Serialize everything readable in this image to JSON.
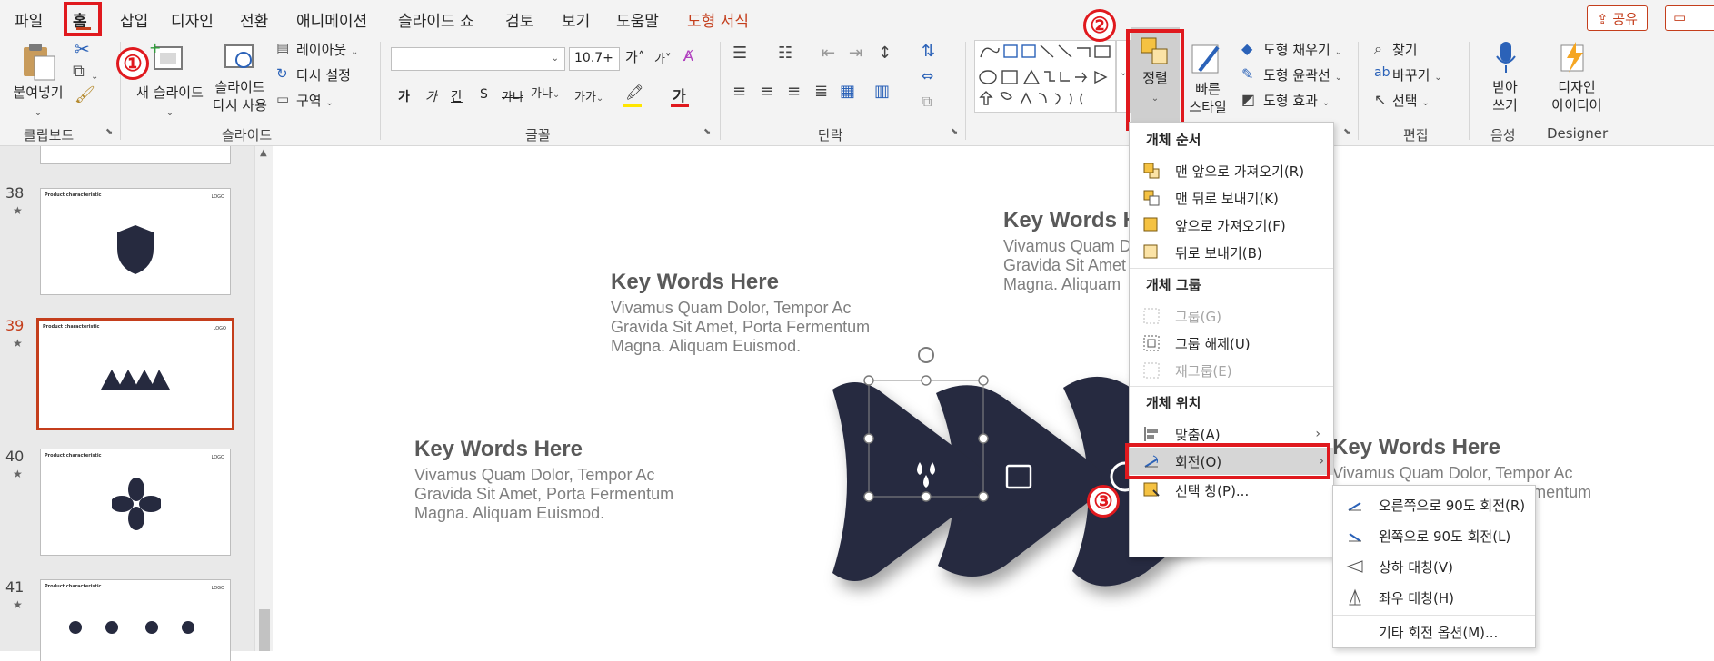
{
  "tabs": {
    "items": [
      "파일",
      "홈",
      "삽입",
      "디자인",
      "전환",
      "애니메이션",
      "슬라이드 쇼",
      "검토",
      "보기",
      "도움말",
      "도형 서식"
    ],
    "share": "공유"
  },
  "badges": [
    "①",
    "②",
    "③"
  ],
  "ribbon": {
    "clipboard": {
      "label": "클립보드",
      "paste": "붙여넣기"
    },
    "slides": {
      "label": "슬라이드",
      "new_slide": "새 슬라이드",
      "reuse": "슬라이드\n다시 사용",
      "layout": "레이아웃",
      "reset": "다시 설정",
      "section": "구역"
    },
    "font": {
      "label": "글꼴",
      "font_name": "",
      "font_size": "10.7+",
      "grow": "가",
      "shrink": "가",
      "bold": "가",
      "italic": "가",
      "underline": "간",
      "shadow": "S",
      "strike": "가나",
      "spacing": "가나",
      "case": "가가",
      "font_color": "가"
    },
    "paragraph": {
      "label": "단락"
    },
    "drawing": {
      "arrange": "정렬",
      "quick_styles": "빠른\n스타일",
      "fill": "도형 채우기",
      "outline": "도형 윤곽선",
      "effects": "도형 효과"
    },
    "editing": {
      "label": "편집",
      "find": "찾기",
      "replace": "바꾸기",
      "select": "선택"
    },
    "voice": {
      "label": "음성",
      "dictate": "받아\n쓰기"
    },
    "designer": {
      "label": "Designer",
      "ideas": "디자인\n아이디어"
    }
  },
  "thumbnails": [
    {
      "num": "38",
      "title": "Product characteristic"
    },
    {
      "num": "39",
      "title": "Product characteristic"
    },
    {
      "num": "40",
      "title": "Product characteristic"
    },
    {
      "num": "41",
      "title": "Product characteristic"
    }
  ],
  "thumb_logo": "LOGO",
  "thumb_star": "★",
  "slide": {
    "blocks": [
      {
        "title": "Key Words Here",
        "lines": [
          "Vivamus Quam Dolor, Tempor Ac",
          "Gravida Sit Amet, Porta Fermentum",
          "Magna. Aliquam Euismod."
        ]
      },
      {
        "title": "Key Words Here",
        "lines": [
          "Vivamus Quam Dolor, Tempor Ac",
          "Gravida Sit Amet, Porta Fermentum",
          "Magna. Aliquam Euismod."
        ]
      },
      {
        "title": "Key Words Here",
        "lines": [
          "Vivamus Quam D",
          "Gravida Sit Amet",
          "Magna. Aliquam"
        ]
      },
      {
        "title": "Key Words Here",
        "lines": [
          "Vivamus Quam Dolor, Tempor Ac",
          "Gravida Sit Amet, Porta Fermentum",
          ""
        ]
      }
    ],
    "shape_color": "#262a3f"
  },
  "arrange_menu": {
    "order_header": "개체 순서",
    "bring_front": "맨 앞으로 가져오기(R)",
    "send_back": "맨 뒤로 보내기(K)",
    "bring_forward": "앞으로 가져오기(F)",
    "send_backward": "뒤로 보내기(B)",
    "group_header": "개체 그룹",
    "group": "그룹(G)",
    "ungroup": "그룹 해제(U)",
    "regroup": "재그룹(E)",
    "position_header": "개체 위치",
    "align": "맞춤(A)",
    "rotate": "회전(O)",
    "selection_pane": "선택 창(P)..."
  },
  "rotate_menu": {
    "right90": "오른쪽으로 90도 회전(R)",
    "left90": "왼쪽으로 90도 회전(L)",
    "flip_v": "상하 대칭(V)",
    "flip_h": "좌우 대칭(H)",
    "more": "기타 회전 옵션(M)..."
  }
}
